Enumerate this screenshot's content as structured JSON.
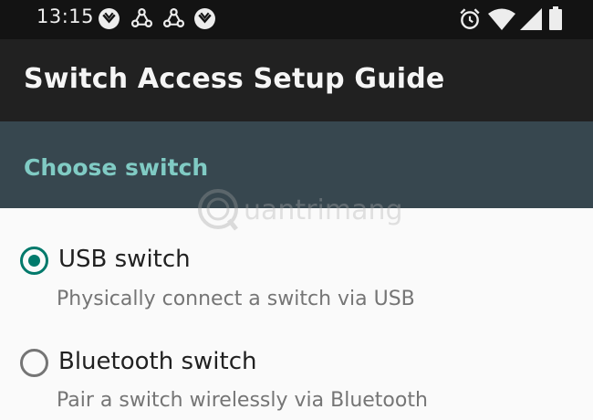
{
  "status_bar": {
    "time": "13:15",
    "notification_icons": [
      "vpn-shield-icon",
      "sync-icon",
      "sync-icon",
      "vpn-shield-icon"
    ],
    "right_icons": [
      "alarm-icon",
      "wifi-icon",
      "signal-icon",
      "battery-icon"
    ]
  },
  "app_bar": {
    "title": "Switch Access Setup Guide"
  },
  "section": {
    "title": "Choose switch"
  },
  "options": [
    {
      "label": "USB switch",
      "description": "Physically connect a switch via USB",
      "selected": true
    },
    {
      "label": "Bluetooth switch",
      "description": "Pair a switch wirelessly via Bluetooth",
      "selected": false
    }
  ],
  "watermark": {
    "text": "uantrimang"
  },
  "colors": {
    "status_bar_bg": "#131313",
    "app_bar_bg": "#212121",
    "section_bg": "#37474f",
    "section_title": "#80cbc4",
    "accent": "#00796b"
  }
}
